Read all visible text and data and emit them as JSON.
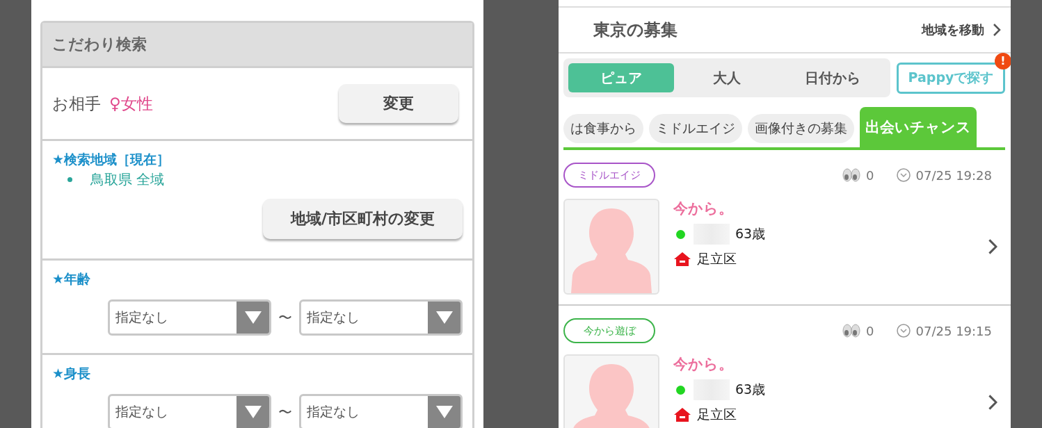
{
  "search_panel": {
    "title": "こだわり検索",
    "partner": {
      "label": "お相手",
      "value": "♀女性",
      "button": "変更"
    },
    "area": {
      "label": "★検索地域［現在］",
      "items": [
        "鳥取県 全域"
      ],
      "button": "地域/市区町村の変更"
    },
    "ranges": [
      {
        "label": "★年齢",
        "from": "指定なし",
        "separator": "〜",
        "to": "指定なし"
      },
      {
        "label": "★身長",
        "from": "指定なし",
        "separator": "〜",
        "to": "指定なし"
      }
    ]
  },
  "board": {
    "title": "東京の募集",
    "region_link": "地域を移動",
    "segments": [
      {
        "label": "ピュア",
        "selected": true
      },
      {
        "label": "大人",
        "selected": false
      },
      {
        "label": "日付から",
        "selected": false
      }
    ],
    "pappy_button": {
      "label": "Pappyで探す",
      "badge": "!"
    },
    "categories": [
      {
        "label": "は食事から",
        "selected": false
      },
      {
        "label": "ミドルエイジ",
        "selected": false
      },
      {
        "label": "画像付きの募集",
        "selected": false
      },
      {
        "label": "出会いチャンス",
        "selected": true
      }
    ],
    "posts": [
      {
        "tag": "ミドルエイジ",
        "color": "#a855c8",
        "views": "0",
        "time": "07/25 19:28",
        "title": "今から。",
        "online": true,
        "age": "63歳",
        "place": "足立区"
      },
      {
        "tag": "今から遊ぼ",
        "color": "#3cb44a",
        "views": "0",
        "time": "07/25 19:15",
        "title": "今から。",
        "online": true,
        "age": "63歳",
        "place": "足立区"
      }
    ]
  }
}
